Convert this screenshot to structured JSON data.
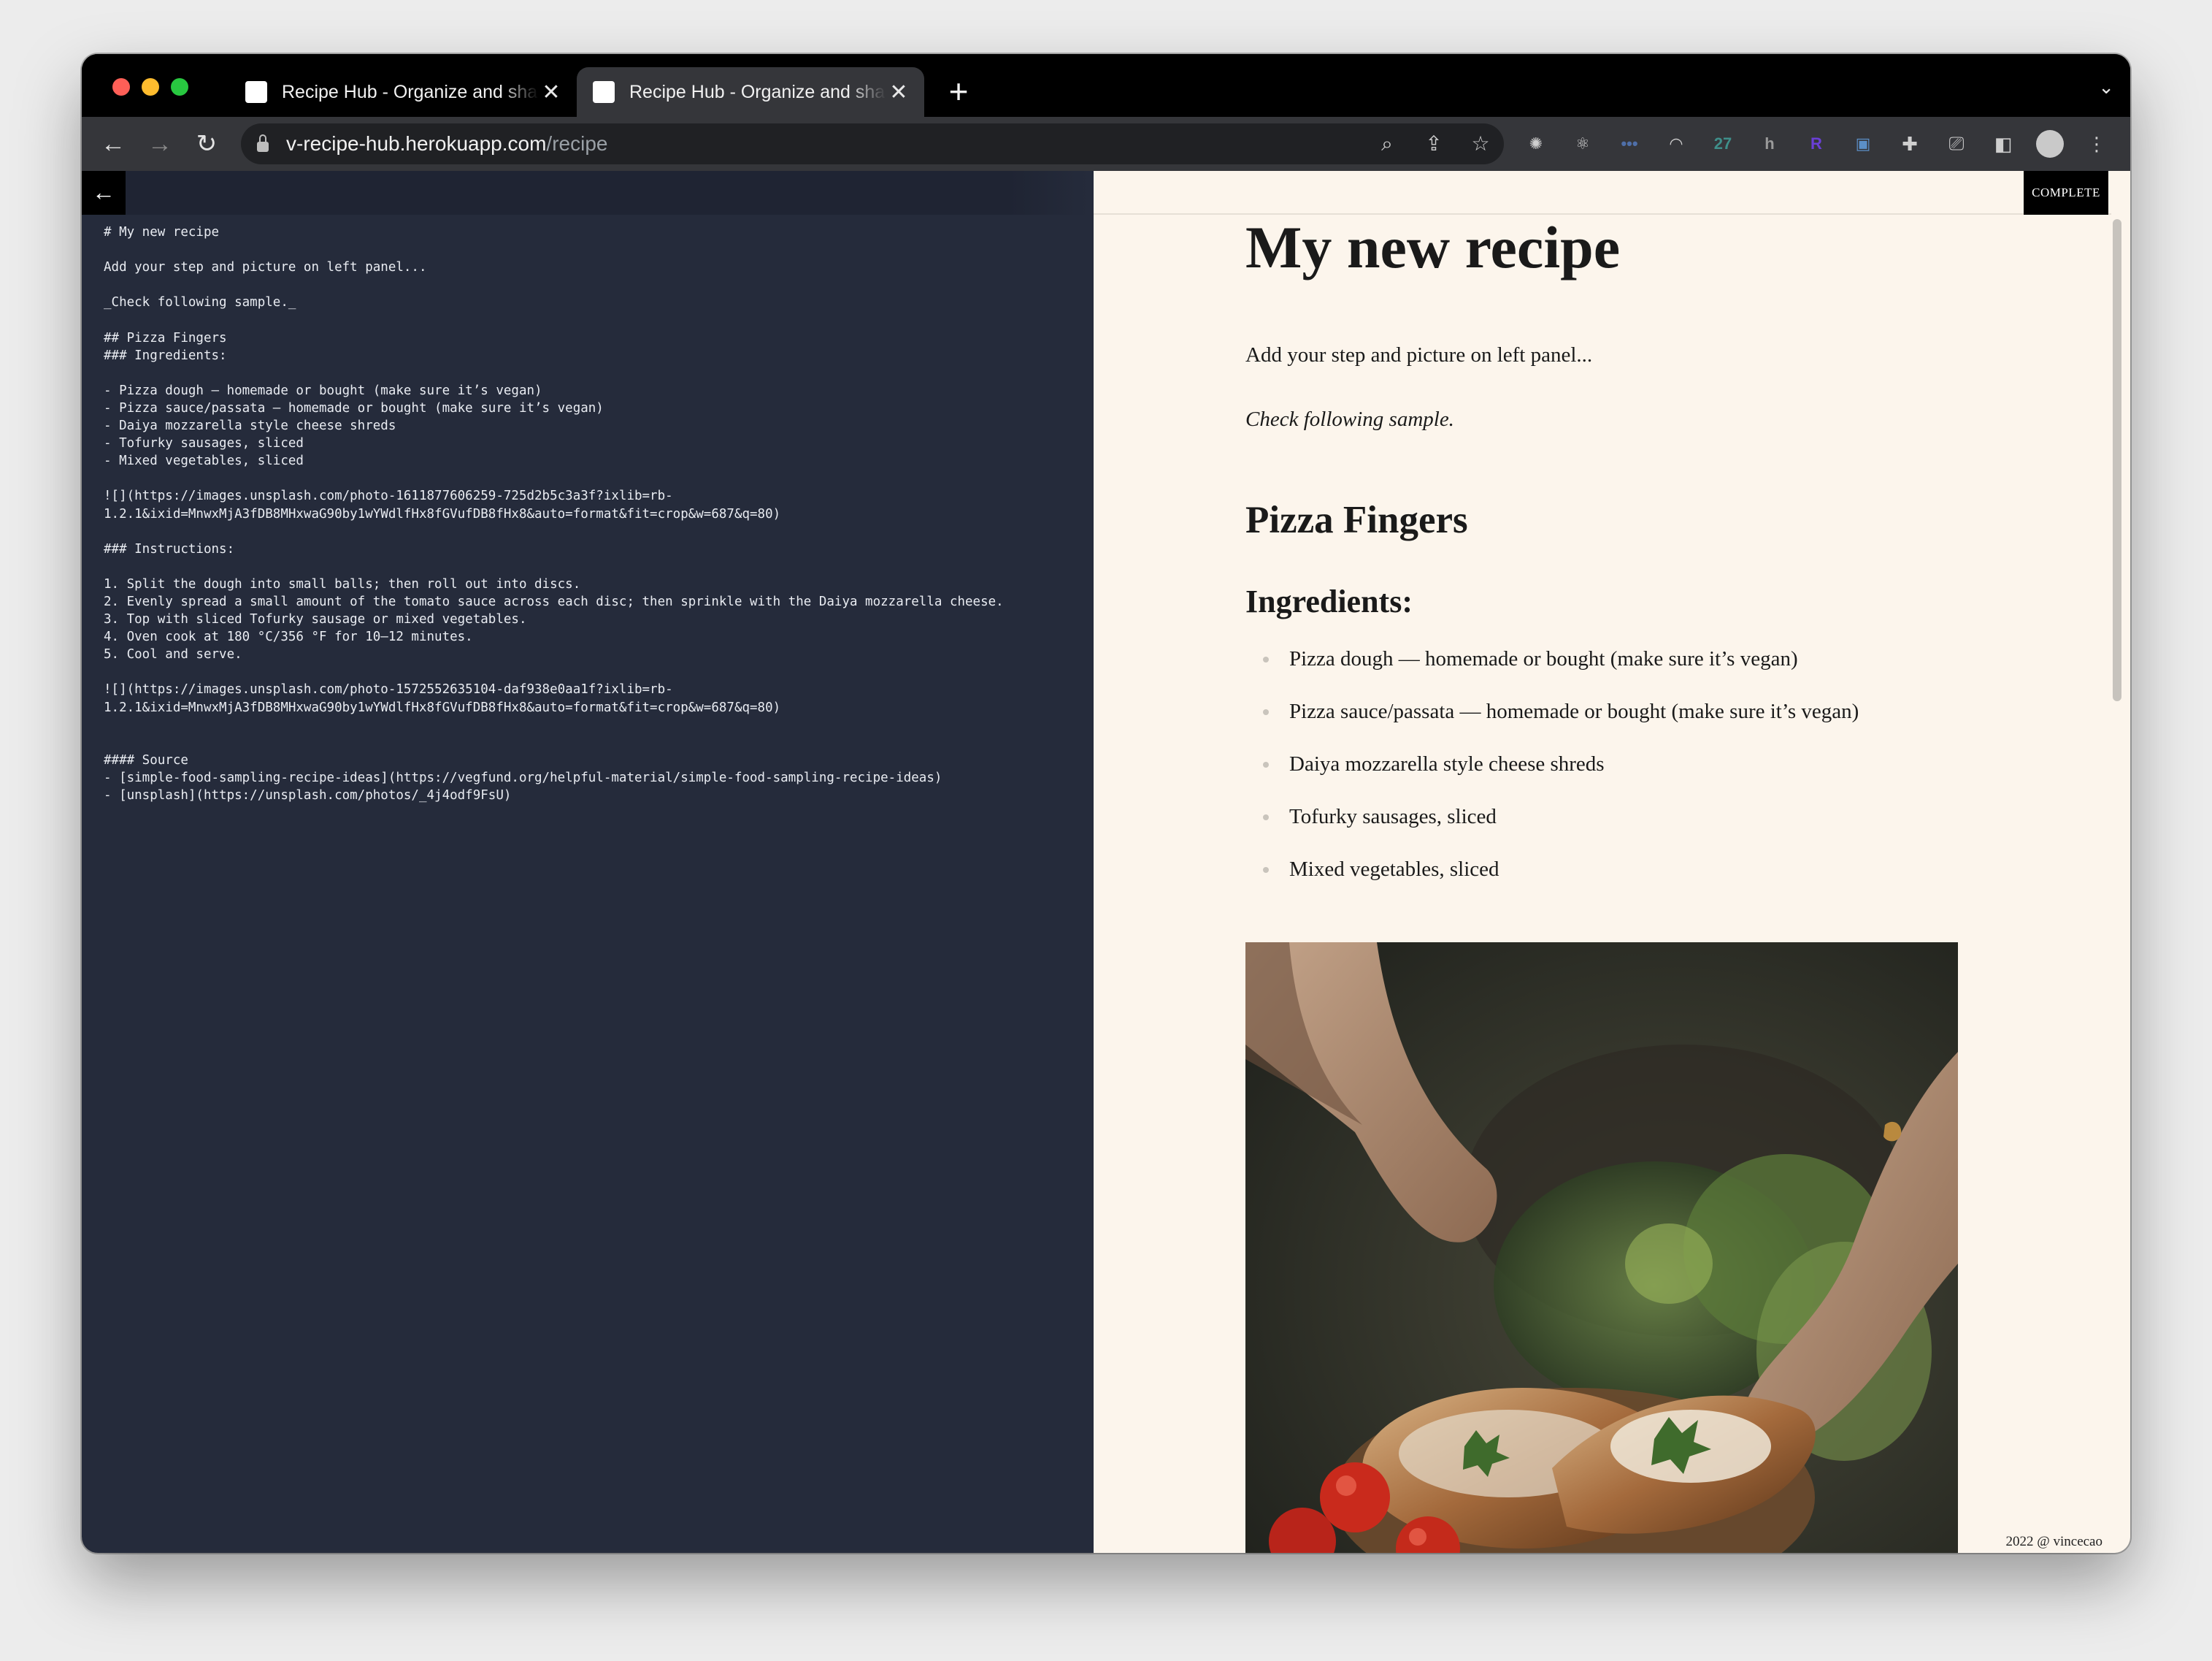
{
  "browser": {
    "tabs": [
      {
        "title": "Recipe Hub - Organize and sha"
      },
      {
        "title": "Recipe Hub - Organize and sha"
      }
    ],
    "url_host": "v-recipe-hub.herokuapp.com",
    "url_path": "/recipe",
    "extensions": [
      {
        "name": "openai-icon",
        "glyph": "✺",
        "color": "#cfcfcf"
      },
      {
        "name": "react-devtools-icon",
        "glyph": "⚛",
        "color": "#cfcfcf"
      },
      {
        "name": "more-dots-extension-icon",
        "glyph": "•••",
        "color": "#4f6fa8"
      },
      {
        "name": "arc-extension-icon",
        "glyph": "◠",
        "color": "#cfcfcf"
      },
      {
        "name": "calendar-extension-icon",
        "glyph": "27",
        "color": "#3f8f8a"
      },
      {
        "name": "translate-extension-icon",
        "glyph": "h",
        "color": "#9a9a9a"
      },
      {
        "name": "r-extension-icon",
        "glyph": "R",
        "color": "#6a3fd6"
      },
      {
        "name": "screenshot-extension-icon",
        "glyph": "▣",
        "color": "#5b8fc7"
      }
    ]
  },
  "editor": {
    "markdown": "# My new recipe\n\nAdd your step and picture on left panel...\n\n_Check following sample._\n\n## Pizza Fingers\n### Ingredients:\n\n- Pizza dough – homemade or bought (make sure it’s vegan)\n- Pizza sauce/passata – homemade or bought (make sure it’s vegan)\n- Daiya mozzarella style cheese shreds\n- Tofurky sausages, sliced\n- Mixed vegetables, sliced\n\n![](https://images.unsplash.com/photo-1611877606259-725d2b5c3a3f?ixlib=rb-\n1.2.1&ixid=MnwxMjA3fDB8MHxwaG90by1wYWdlfHx8fGVufDB8fHx8&auto=format&fit=crop&w=687&q=80)\n\n### Instructions:\n\n1. Split the dough into small balls; then roll out into discs.\n2. Evenly spread a small amount of the tomato sauce across each disc; then sprinkle with the Daiya mozzarella cheese.\n3. Top with sliced Tofurky sausage or mixed vegetables.\n4. Oven cook at 180 °C/356 °F for 10–12 minutes.\n5. Cool and serve.\n\n![](https://images.unsplash.com/photo-1572552635104-daf938e0aa1f?ixlib=rb-\n1.2.1&ixid=MnwxMjA3fDB8MHxwaG90by1wYWdlfHx8fGVufDB8fHx8&auto=format&fit=crop&w=687&q=80)\n\n\n#### Source\n- [simple-food-sampling-recipe-ideas](https://vegfund.org/helpful-material/simple-food-sampling-recipe-ideas)\n- [unsplash](https://unsplash.com/photos/_4j4odf9FsU)"
  },
  "preview": {
    "complete_label": "COMPLETE",
    "title": "My new recipe",
    "intro": "Add your step and picture on left panel...",
    "sample_note": "Check following sample.",
    "recipe_name": "Pizza Fingers",
    "ingredients_heading": "Ingredients:",
    "ingredients": [
      "Pizza dough — homemade or bought (make sure it’s vegan)",
      "Pizza sauce/passata — homemade or bought (make sure it’s vegan)",
      "Daiya mozzarella style cheese shreds",
      "Tofurky sausages, sliced",
      "Mixed vegetables, sliced"
    ],
    "footer": "2022 @ vincecao"
  }
}
